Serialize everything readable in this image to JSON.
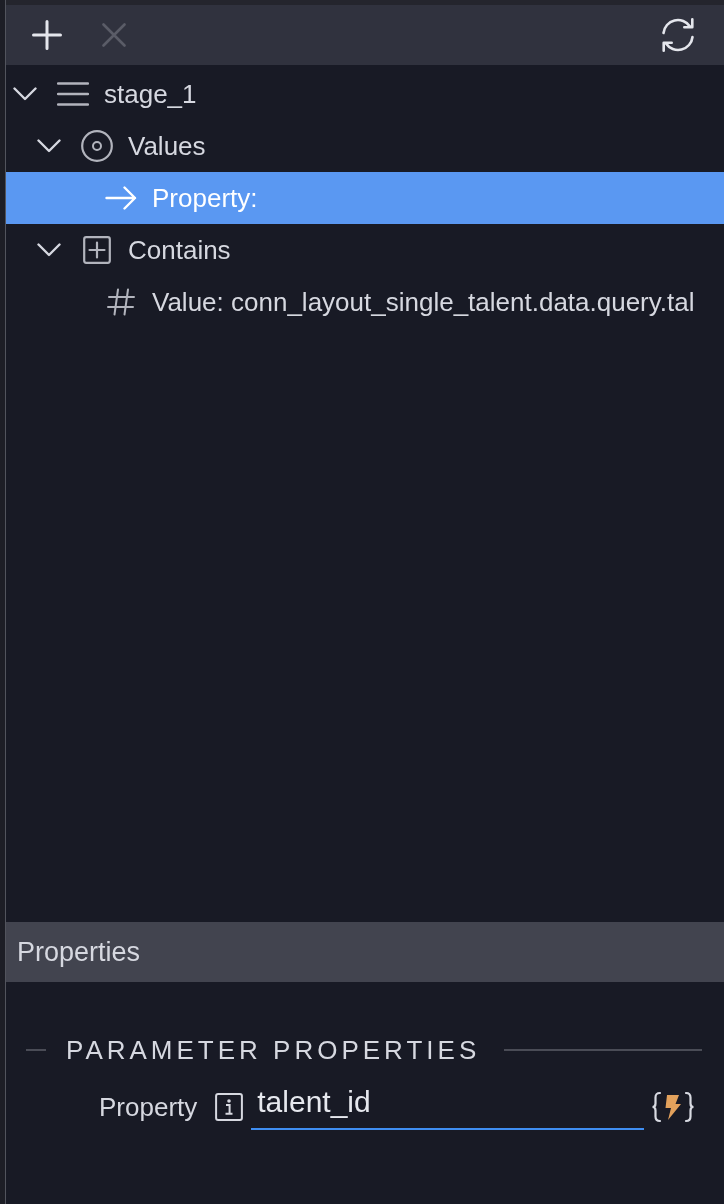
{
  "toolbar": {
    "buttons": [
      {
        "kind": "add",
        "disabled": false
      },
      {
        "kind": "remove",
        "disabled": true
      },
      {
        "kind": "refresh",
        "disabled": false
      }
    ]
  },
  "tree": [
    {
      "kind": "stage",
      "label": "stage_1",
      "selected": false,
      "expanded": true,
      "children": [
        {
          "kind": "values",
          "label": "Values",
          "selected": false,
          "expanded": true,
          "children": [
            {
              "kind": "property",
              "label": "Property:",
              "selected": true
            }
          ]
        },
        {
          "kind": "contains",
          "label": "Contains",
          "selected": false,
          "expanded": true,
          "children": [
            {
              "kind": "value",
              "label": "Value: conn_layout_single_talent.data.query.tal",
              "selected": false
            }
          ]
        }
      ]
    }
  ],
  "properties_panel": {
    "title": "Properties",
    "section": "PARAMETER PROPERTIES",
    "fields": [
      {
        "label": "Property",
        "value": "talent_id",
        "focused": true
      }
    ]
  }
}
